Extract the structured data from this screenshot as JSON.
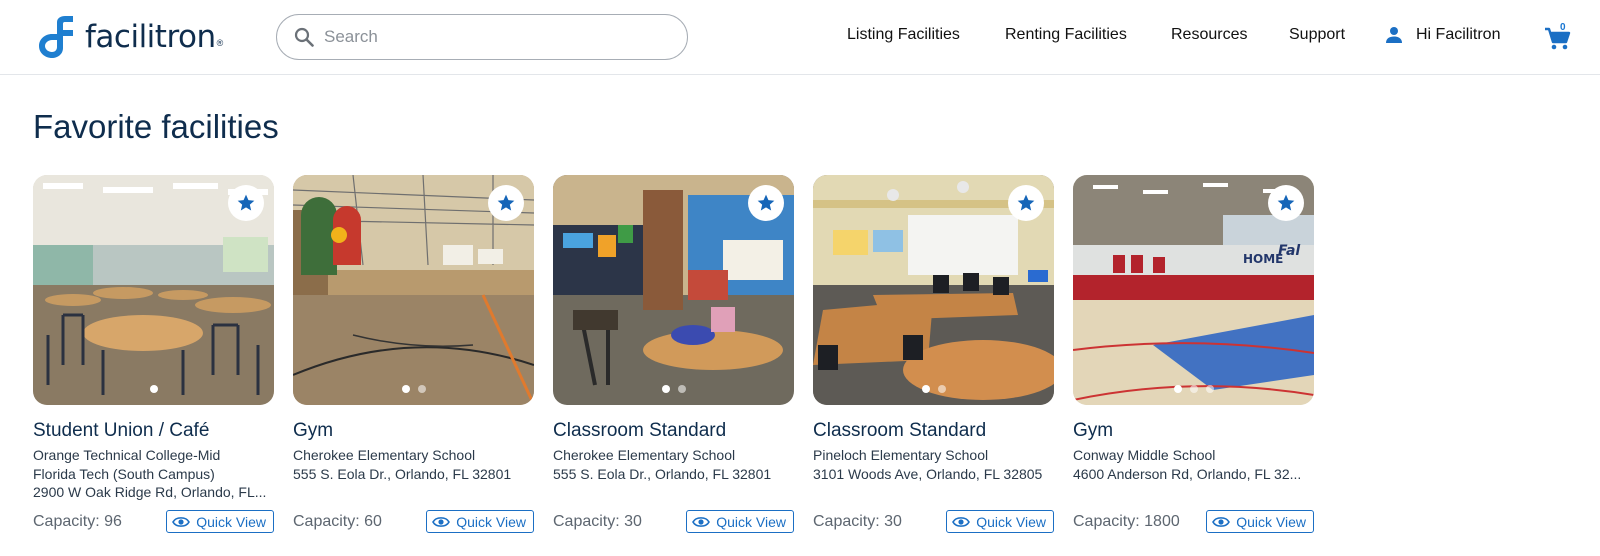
{
  "header": {
    "logo_text": "facilitron",
    "logo_reg": "®",
    "search_placeholder": "Search",
    "nav": [
      "Listing Facilities",
      "Renting Facilities",
      "Resources",
      "Support"
    ],
    "user_greeting": "Hi Facilitron",
    "cart_count": "0"
  },
  "main": {
    "title": "Favorite facilities",
    "quick_view_label": "Quick View",
    "cards": [
      {
        "name": "Student Union / Café",
        "address_lines": [
          "Orange Technical College-Mid",
          "Florida Tech (South Campus)",
          "2900 W Oak Ridge Rd, Orlando, FL..."
        ],
        "capacity": "Capacity: 96",
        "photo_count": 1,
        "scene": "cafeteria"
      },
      {
        "name": "Gym",
        "address_lines": [
          "Cherokee Elementary School",
          "555 S. Eola Dr., Orlando, FL 32801"
        ],
        "capacity": "Capacity: 60",
        "photo_count": 2,
        "scene": "gym-small"
      },
      {
        "name": "Classroom Standard",
        "address_lines": [
          "Cherokee Elementary School",
          "555 S. Eola Dr., Orlando, FL 32801"
        ],
        "capacity": "Capacity: 30",
        "photo_count": 2,
        "scene": "classroom-1"
      },
      {
        "name": "Classroom Standard",
        "address_lines": [
          "Pineloch Elementary School",
          "3101 Woods Ave, Orlando, FL 32805"
        ],
        "capacity": "Capacity: 30",
        "photo_count": 2,
        "scene": "classroom-2"
      },
      {
        "name": "Gym",
        "address_lines": [
          "Conway Middle School",
          "4600 Anderson Rd, Orlando, FL 32..."
        ],
        "capacity": "Capacity: 1800",
        "photo_count": 3,
        "scene": "gym-large"
      }
    ]
  },
  "colors": {
    "brand_navy": "#0f2d4d",
    "accent_blue": "#1b6fc4",
    "star_blue": "#1565b8"
  }
}
